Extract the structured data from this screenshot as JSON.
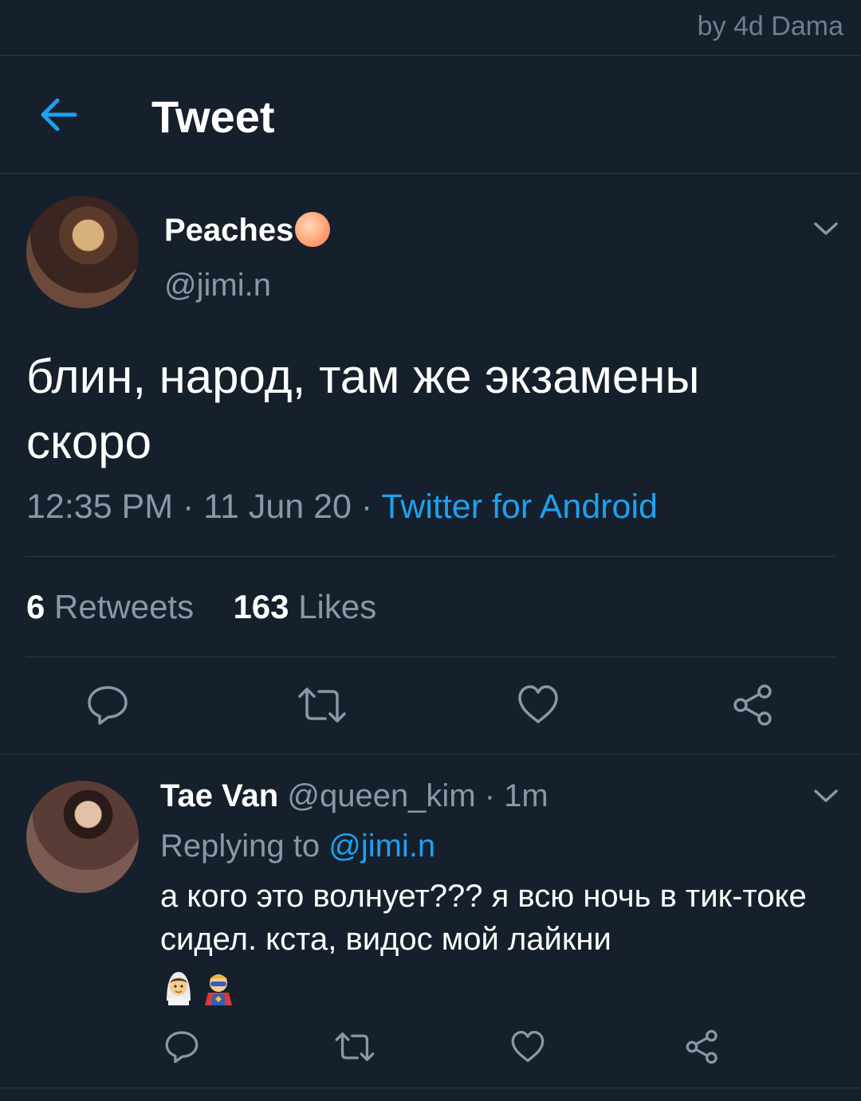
{
  "watermark": "by 4d Dama",
  "header": {
    "title": "Tweet"
  },
  "tweet": {
    "author_name": "Peaches",
    "author_handle": "@jimi.n",
    "text": "блин, народ, там же экзамены скоро",
    "time": "12:35 PM · 11 Jun 20 · ",
    "source": "Twitter for Android",
    "retweets_count": "6",
    "retweets_label": " Retweets",
    "likes_count": "163",
    "likes_label": " Likes"
  },
  "reply": {
    "author_name": "Tae Van",
    "handle_time": " @queen_kim · 1m",
    "replying_label": "Replying to ",
    "replying_handle": "@jimi.n",
    "text": "а кого это волнует??? я всю ночь в тик-токе сидел. кста, видос мой лайкни",
    "emojis": [
      "bride-emoji",
      "superhero-emoji"
    ]
  },
  "colors": {
    "background": "#16202c",
    "accent": "#1da1f2",
    "muted": "#8899a6",
    "divider": "#2c3846"
  }
}
